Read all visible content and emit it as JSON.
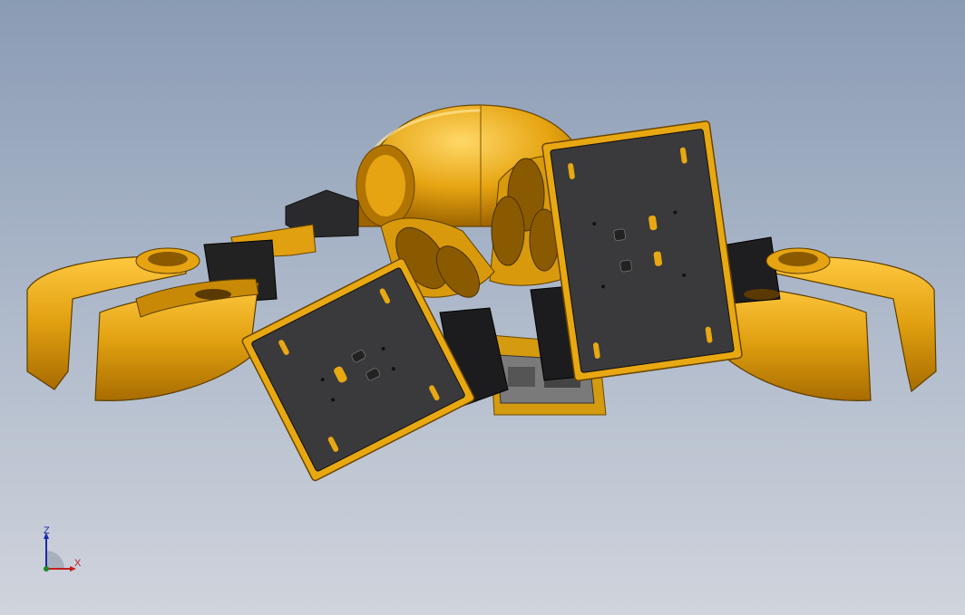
{
  "viewport": {
    "background_top": "#8a9bb4",
    "background_bottom": "#d0d4dc"
  },
  "model": {
    "body_color": "#e0a010",
    "body_shadow": "#a86c00",
    "body_highlight": "#ffd060",
    "plate_color": "#3a3a3c",
    "plate_border": "#e8a812",
    "servo_color": "#1c1c1e",
    "frame_color": "#8c8c8c"
  },
  "triad": {
    "z_label": "Z",
    "x_label": "X",
    "z_color": "#1a2aa8",
    "x_color": "#c02020",
    "y_color": "#1a8a2a"
  }
}
